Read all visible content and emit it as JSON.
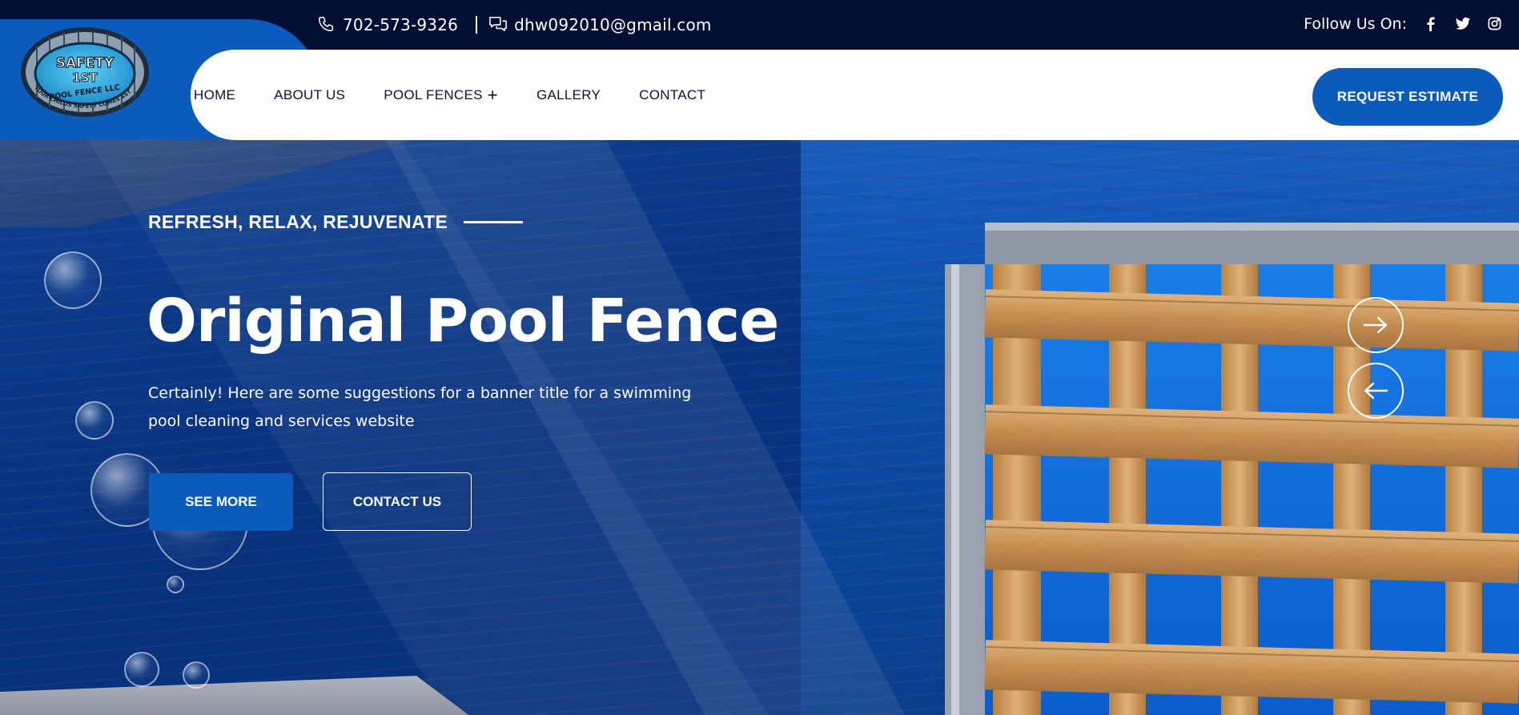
{
  "topbar": {
    "phone": "702-573-9326",
    "email": "dhw092010@gmail.com",
    "follow_label": "Follow Us On:",
    "phone_icon": "phone-icon",
    "email_icon": "chat-bubbles-icon",
    "socials": [
      "facebook-icon",
      "twitter-icon",
      "instagram-icon"
    ]
  },
  "logo": {
    "line1": "SAFETY",
    "line2": "1ST",
    "line3": "POOL FENCE LLC",
    "ring_text": "YOUR CHILDS SAFETY COMES 1ST"
  },
  "nav": {
    "items": [
      {
        "label": "HOME"
      },
      {
        "label": "ABOUT US"
      },
      {
        "label": "POOL FENCES",
        "has_submenu": true,
        "submenu_icon": "+"
      },
      {
        "label": "GALLERY"
      },
      {
        "label": "CONTACT"
      }
    ],
    "cta_label": "REQUEST ESTIMATE"
  },
  "hero": {
    "tagline": "REFRESH, RELAX, REJUVENATE",
    "title": "Original Pool Fence",
    "description": "Certainly! Here are some suggestions for a banner title for a swimming pool cleaning and services website",
    "primary_button": "SEE MORE",
    "secondary_button": "CONTACT US",
    "next_icon": "arrow-right-icon",
    "prev_icon": "arrow-left-icon"
  },
  "colors": {
    "topbar_bg": "#020f33",
    "brand_blue": "#0b5bbb",
    "nav_text": "#0b1533",
    "white": "#ffffff"
  }
}
